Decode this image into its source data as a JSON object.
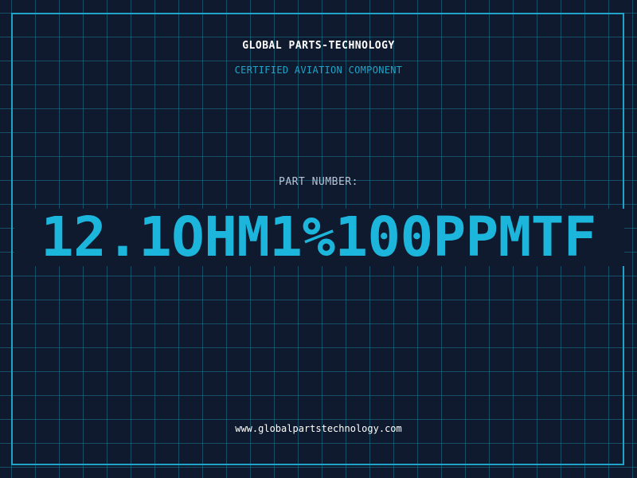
{
  "header": {
    "company": "GLOBAL PARTS-TECHNOLOGY",
    "subtitle": "CERTIFIED AVIATION COMPONENT"
  },
  "part": {
    "label": "PART NUMBER:",
    "number": "12.1OHM1%100PPMTF"
  },
  "footer": {
    "website": "www.globalpartstechnology.com"
  },
  "colors": {
    "background": "#101a2e",
    "grid": "#1c7896",
    "accent": "#1fa3c8",
    "part_number": "#1cb6dc",
    "text": "#ffffff",
    "label": "#b7c3d4"
  }
}
